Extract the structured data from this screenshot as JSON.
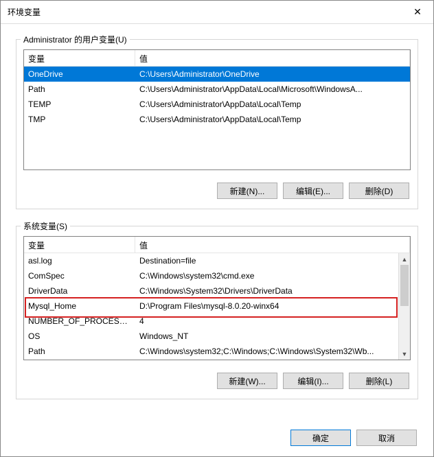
{
  "window": {
    "title": "环境变量",
    "close_icon": "✕"
  },
  "user_vars": {
    "group_label": "Administrator 的用户变量(U)",
    "headers": {
      "name": "变量",
      "value": "值"
    },
    "rows": [
      {
        "name": "OneDrive",
        "value": "C:\\Users\\Administrator\\OneDrive",
        "selected": true
      },
      {
        "name": "Path",
        "value": "C:\\Users\\Administrator\\AppData\\Local\\Microsoft\\WindowsA..."
      },
      {
        "name": "TEMP",
        "value": "C:\\Users\\Administrator\\AppData\\Local\\Temp"
      },
      {
        "name": "TMP",
        "value": "C:\\Users\\Administrator\\AppData\\Local\\Temp"
      }
    ],
    "buttons": {
      "new": "新建(N)...",
      "edit": "编辑(E)...",
      "delete": "删除(D)"
    }
  },
  "sys_vars": {
    "group_label": "系统变量(S)",
    "headers": {
      "name": "变量",
      "value": "值"
    },
    "rows": [
      {
        "name": "asl.log",
        "value": "Destination=file"
      },
      {
        "name": "ComSpec",
        "value": "C:\\Windows\\system32\\cmd.exe"
      },
      {
        "name": "DriverData",
        "value": "C:\\Windows\\System32\\Drivers\\DriverData"
      },
      {
        "name": "Mysql_Home",
        "value": "D:\\Program Files\\mysql-8.0.20-winx64",
        "highlight": true
      },
      {
        "name": "NUMBER_OF_PROCESSORS",
        "value": "4"
      },
      {
        "name": "OS",
        "value": "Windows_NT"
      },
      {
        "name": "Path",
        "value": "C:\\Windows\\system32;C:\\Windows;C:\\Windows\\System32\\Wb..."
      }
    ],
    "buttons": {
      "new": "新建(W)...",
      "edit": "编辑(I)...",
      "delete": "删除(L)"
    },
    "scroll": {
      "up": "▲",
      "down": "▼"
    }
  },
  "dialog_buttons": {
    "ok": "确定",
    "cancel": "取消"
  }
}
